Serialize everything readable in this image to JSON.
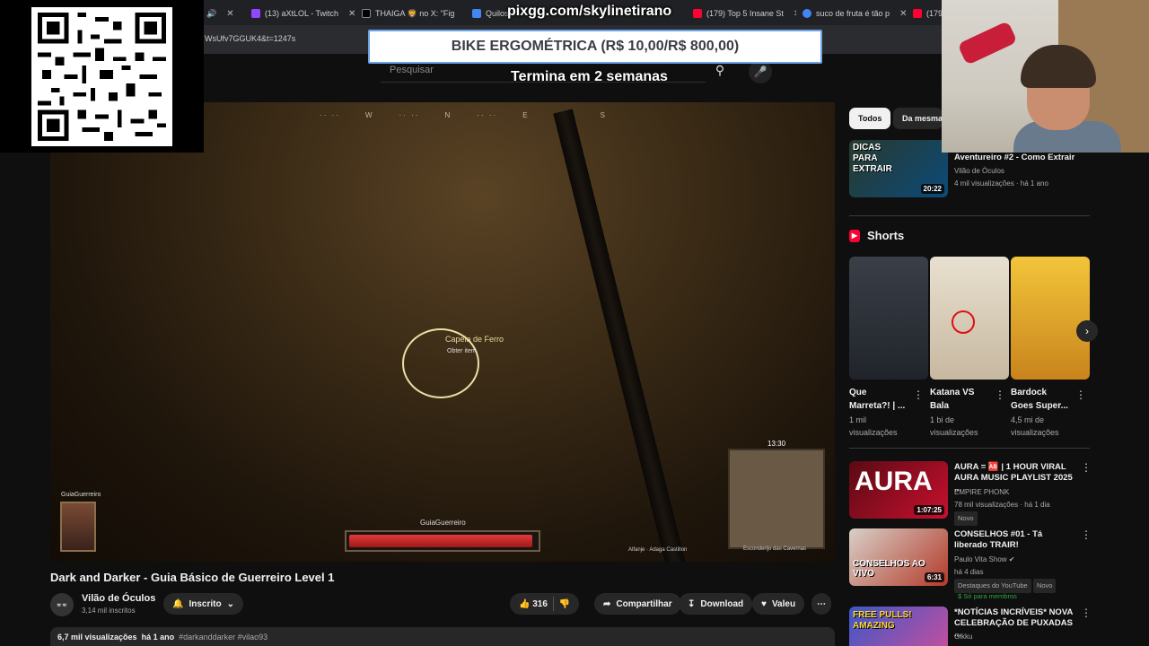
{
  "browser": {
    "tabs": [
      {
        "label": "(13) aXtLOL - Twitch",
        "color": "#9146ff"
      },
      {
        "label": "THAIGA 🦁 no X: \"Fig",
        "color": "#000000"
      },
      {
        "label": "Quilos",
        "color": "#4285f4"
      },
      {
        "label": "(179) Top 5 Insane St",
        "color": "#ff0033"
      },
      {
        "label": "suco de fruta é tão p",
        "color": "#4285f4"
      },
      {
        "label": "(179)",
        "color": "#ff0033"
      }
    ],
    "url": "WsUfv7GGUK4&t=1247s"
  },
  "overlay": {
    "pix_url": "pixgg.com/skylinetirano",
    "banner": "BIKE ERGOMÉTRICA (R$ 10,00/R$ 800,00)",
    "banner_sub": "Termina em 2 semanas"
  },
  "search": {
    "placeholder": "Pesquisar"
  },
  "game": {
    "compass": [
      "W",
      "N",
      "E",
      "S"
    ],
    "loot_label": "Capela de Ferro",
    "loot_action": "Obter item",
    "player_name": "GuiaGuerreiro",
    "hud_name": "GuiaGuerreiro",
    "hp_fraction": 0.98,
    "timer": "13:30",
    "minimap_label": "Esconderijo das Cavernas",
    "weapon_label": "Alfanje · Adaga Castillon"
  },
  "video": {
    "title": "Dark and Darker - Guia Básico de Guerreiro Level 1",
    "channel": "Vilão de Óculos",
    "subs": "3,14 mil inscritos",
    "subscribe_label": "Inscrito",
    "likes": "316",
    "share_label": "Compartilhar",
    "download_label": "Download",
    "thanks_label": "Valeu",
    "views": "6,7 mil visualizações",
    "age": "há 1 ano",
    "tags": "#darkanddarker #vilao93"
  },
  "sidebar": {
    "chips": [
      "Todos",
      "Da mesma série"
    ],
    "first_video": {
      "thumb_text": "DICAS PARA EXTRAIR",
      "duration": "20:22",
      "title": "Aventureiro #2 - Como Extrair",
      "channel": "Vilão de Óculos",
      "meta": "4 mil visualizações · há 1 ano"
    },
    "shorts_title": "Shorts",
    "shorts": [
      {
        "title": "Que Marreta?! | ...",
        "views": "1 mil visualizações",
        "color": "#3a3f48"
      },
      {
        "title": "Katana VS Bala",
        "views": "1 bi de visualizações",
        "color": "#d9cdb8"
      },
      {
        "title": "Bardock Goes Super...",
        "views": "4,5 mi de visualizações",
        "color": "#d9a22a"
      }
    ],
    "videos": [
      {
        "thumb": "AURA",
        "thumb_color": "#c8102e",
        "duration": "1:07:25",
        "title": "AURA = 🆎 | 1 HOUR VIRAL AURA MUSIC PLAYLIST 2025 ...",
        "channel": "EMPIRE PHONK",
        "meta": "78 mil visualizações · há 1 dia",
        "badge": "Novo"
      },
      {
        "thumb": "CONSELHOS AO VIVO",
        "thumb_color": "#b33a2a",
        "duration": "6:31",
        "title": "CONSELHOS #01 - Tá liberado TRAIR!",
        "channel": "Paulo Vita Show ✔",
        "meta": "há 4 dias",
        "badge": "Destaques do YouTube",
        "badge2": "Novo",
        "badge3": "$ Só para membros"
      },
      {
        "thumb": "FREE PULLS! AMAZING",
        "thumb_color": "#7b3fb0",
        "duration": "",
        "title": "*NOTÍCIAS INCRÍVEIS* NOVA CELEBRAÇÃO DE PUXADAS ...",
        "channel": "Gikku",
        "meta": ""
      }
    ]
  },
  "colors": {
    "accent": "#ff0033",
    "bg": "#0f0f0f",
    "chip": "#272727"
  }
}
